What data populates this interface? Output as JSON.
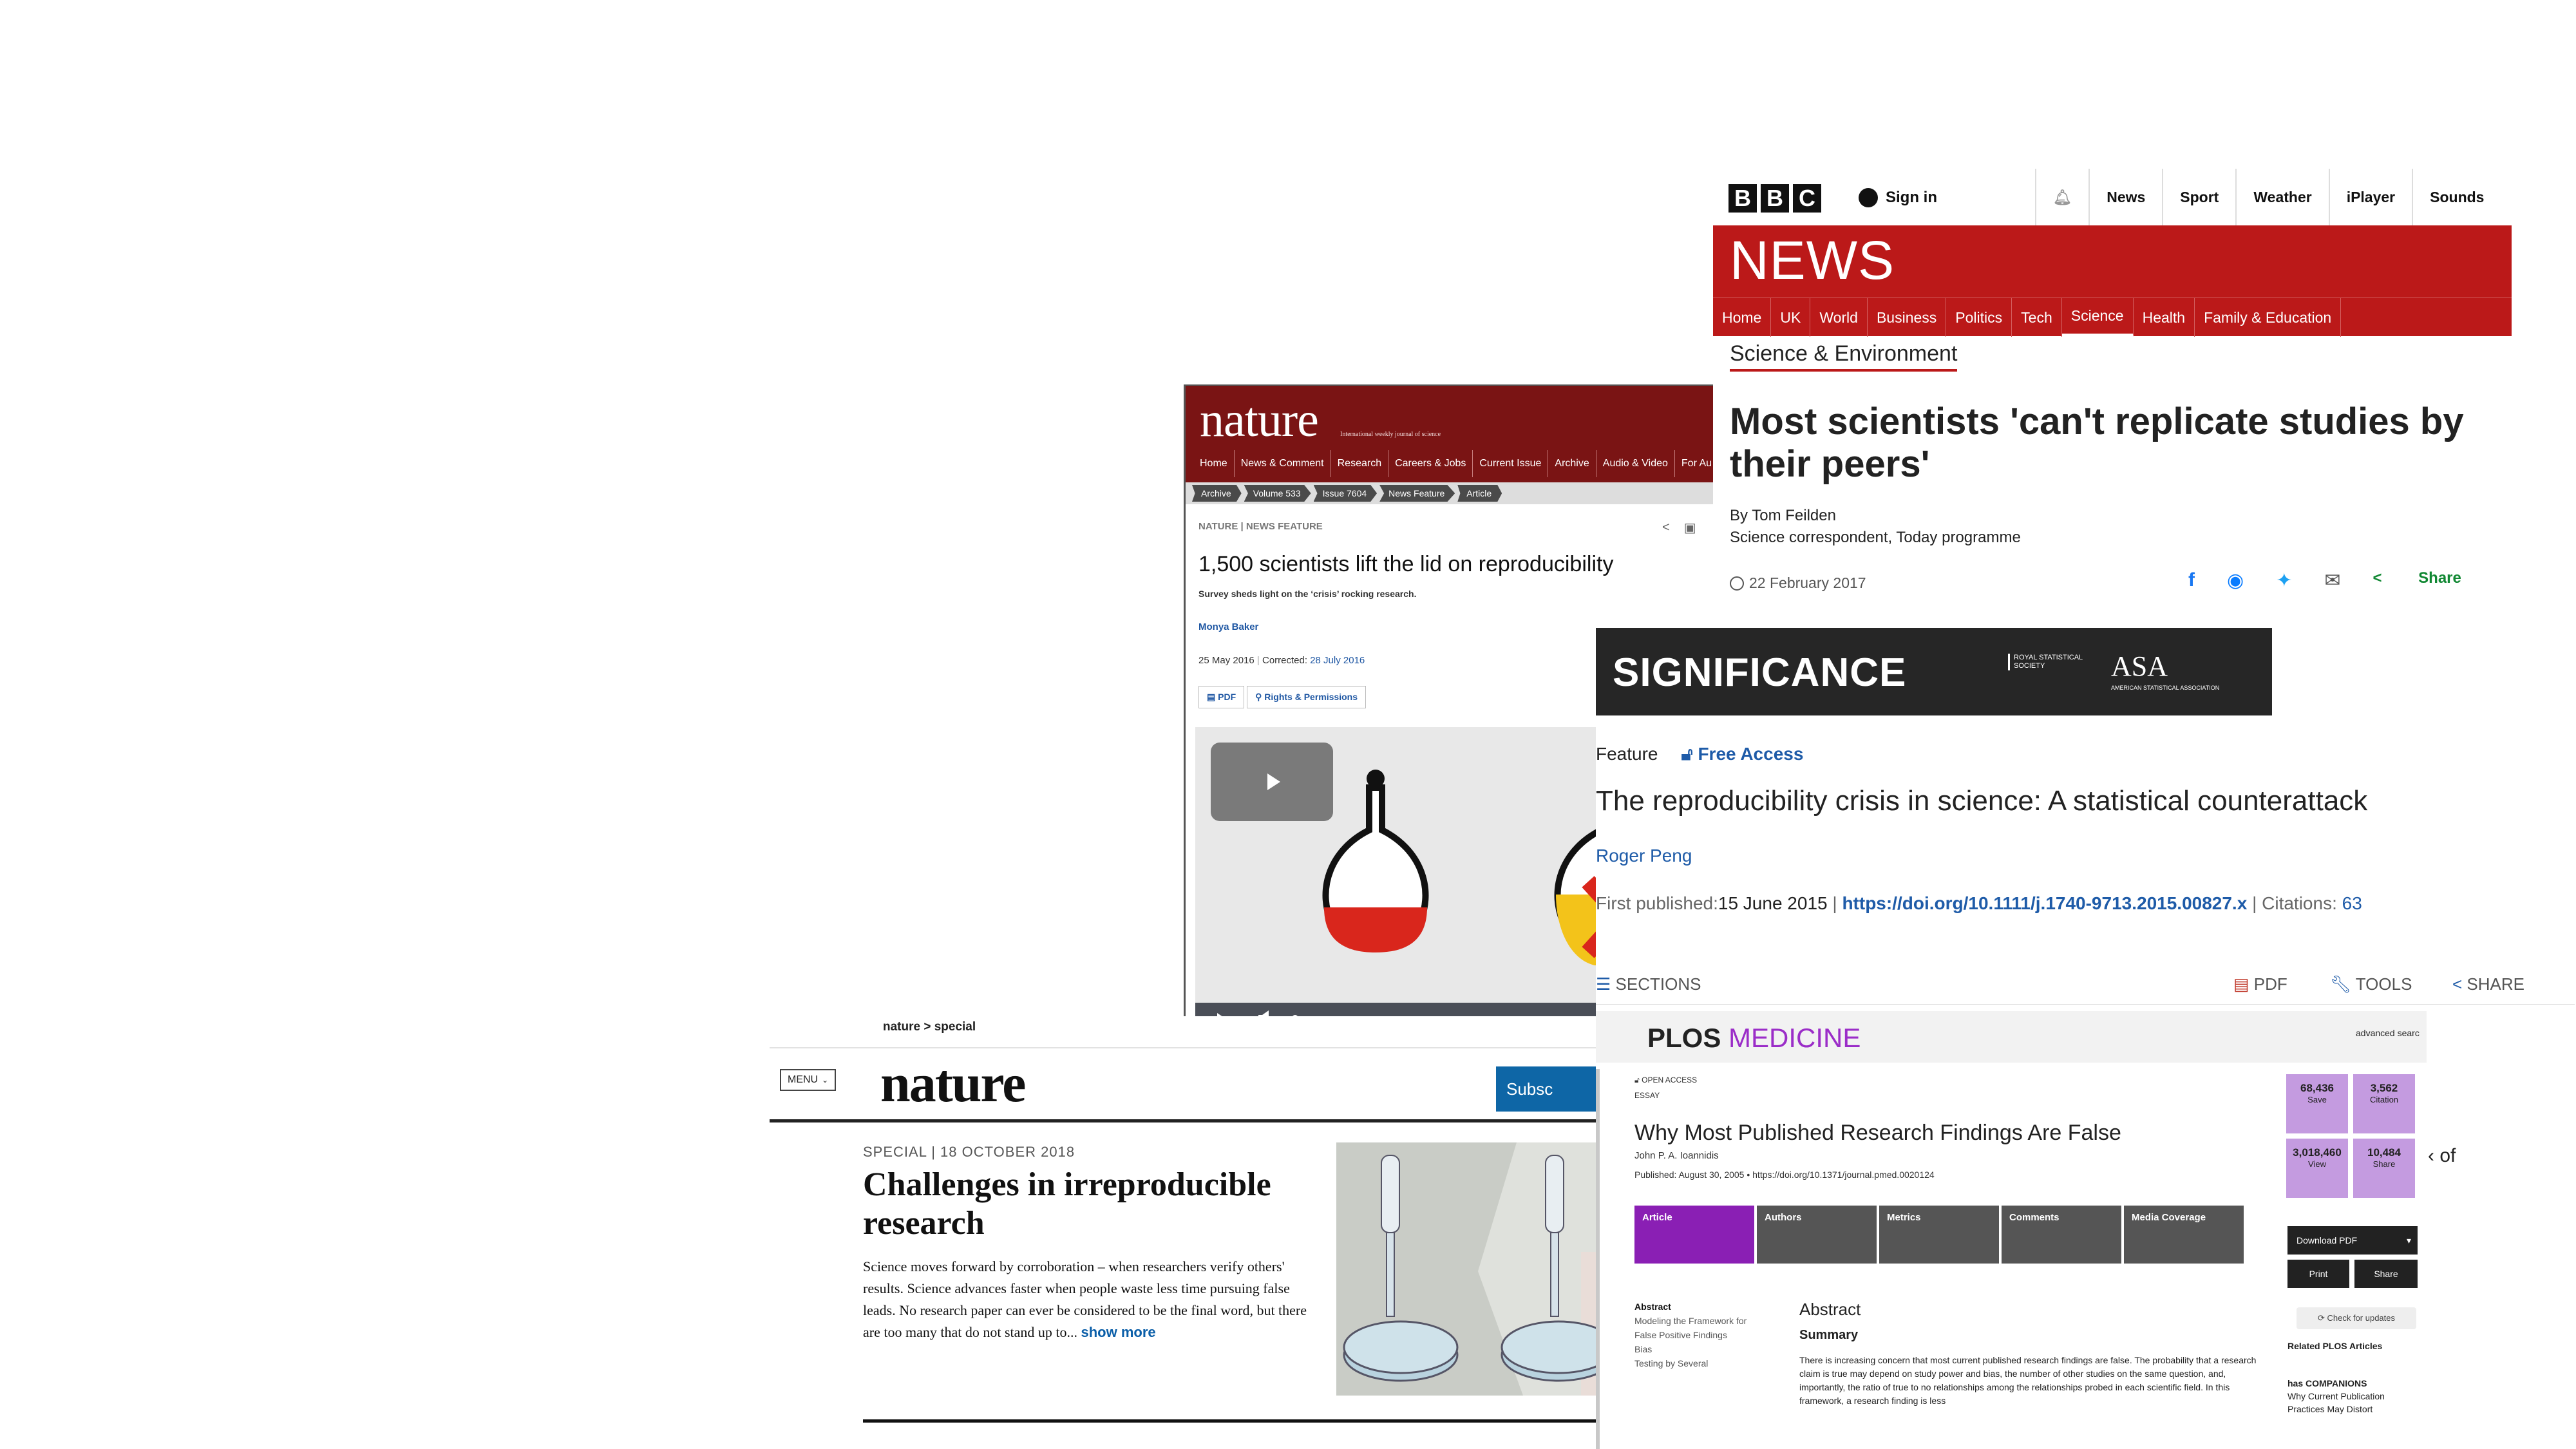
{
  "nature_feature": {
    "logo": "nature",
    "tagline": "International weekly journal of science",
    "nav": [
      "Home",
      "News & Comment",
      "Research",
      "Careers & Jobs",
      "Current Issue",
      "Archive",
      "Audio & Video",
      "For Au"
    ],
    "breadcrumbs": [
      "Archive",
      "Volume 533",
      "Issue 7604",
      "News Feature",
      "Article"
    ],
    "kicker": "NATURE | NEWS FEATURE",
    "title": "1,500 scientists lift the lid on reproducibility",
    "subtitle": "Survey sheds light on the ‘crisis’ rocking research.",
    "author": "Monya Baker",
    "date": "25 May 2016",
    "corrected_label": "Corrected:",
    "corrected_date": "28 July 2016",
    "pdf_label": "PDF",
    "rights_label": "Rights & Permissions"
  },
  "nature_special": {
    "breadcrumb": "nature > special",
    "menu_label": "MENU",
    "logo": "nature",
    "subscribe_label": "Subsc",
    "kicker": "SPECIAL | 18 OCTOBER 2018",
    "title": "Challenges in irreproducible research",
    "body": "Science moves forward by corroboration – when researchers verify others' results. Science advances faster when people waste less time pursuing false leads. No research paper can ever be considered to be the final word, but there are too many that do not stand up to...",
    "show_more": "show more"
  },
  "bbc": {
    "blocks": [
      "B",
      "B",
      "C"
    ],
    "sign_in": "Sign in",
    "top_nav": [
      "News",
      "Sport",
      "Weather",
      "iPlayer",
      "Sounds"
    ],
    "news_title": "NEWS",
    "nav": [
      "Home",
      "UK",
      "World",
      "Business",
      "Politics",
      "Tech",
      "Science",
      "Health",
      "Family & Education"
    ],
    "active_nav": "Science",
    "section": "Science & Environment",
    "headline": "Most scientists 'can't replicate studies by their peers'",
    "byline": "By Tom Feilden",
    "role": "Science correspondent, Today programme",
    "date": "22 February 2017",
    "share_label": "Share",
    "accent": "#bb1919"
  },
  "significance": {
    "banner": "SIGNIFICANCE",
    "rss": "ROYAL STATISTICAL SOCIETY",
    "asa": "ASA",
    "asa_sub": "AMERICAN STATISTICAL ASSOCIATION",
    "type": "Feature",
    "access": "Free Access",
    "title": "The reproducibility crisis in science: A statistical counterattack",
    "author": "Roger Peng",
    "first_published_label": "First published:",
    "first_published": "15 June 2015",
    "doi": "https://doi.org/10.1111/j.1740-9713.2015.00827.x",
    "citations_label": "Citations:",
    "citations": "63",
    "sections_label": "SECTIONS",
    "pdf_label": "PDF",
    "tools_label": "TOOLS",
    "share_label": "SHARE"
  },
  "plos": {
    "brand_a": "PLOS",
    "brand_b": "MEDICINE",
    "advanced_search": "advanced searc",
    "open_access": "OPEN ACCESS",
    "type": "ESSAY",
    "title": "Why Most Published Research Findings Are False",
    "author": "John P. A. Ioannidis",
    "published": "Published: August 30, 2005 • https://doi.org/10.1371/journal.pmed.0020124",
    "tabs": [
      "Article",
      "Authors",
      "Metrics",
      "Comments",
      "Media Coverage"
    ],
    "toc": [
      "Abstract",
      "Modeling the Framework for False Positive Findings",
      "Bias",
      "Testing by Several"
    ],
    "abstract_heading": "Abstract",
    "summary_heading": "Summary",
    "abstract_text": "There is increasing concern that most current published research findings are false. The probability that a research claim is true may depend on study power and bias, the number of other studies on the same question, and, importantly, the ratio of true to no relationships among the relationships probed in each scientific field. In this framework, a research finding is less",
    "metrics": [
      {
        "value": "68,436",
        "label": "Save"
      },
      {
        "value": "3,562",
        "label": "Citation"
      },
      {
        "value": "3,018,460",
        "label": "View"
      },
      {
        "value": "10,484",
        "label": "Share"
      }
    ],
    "of_label": "‹ of",
    "download_label": "Download PDF",
    "print_label": "Print",
    "share_label": "Share",
    "check_updates": "Check for updates",
    "related_label": "Related PLOS Articles",
    "companions_title": "has COMPANIONS",
    "companions_text": "Why Current Publication Practices May Distort",
    "accent": "#9b2dc8"
  }
}
